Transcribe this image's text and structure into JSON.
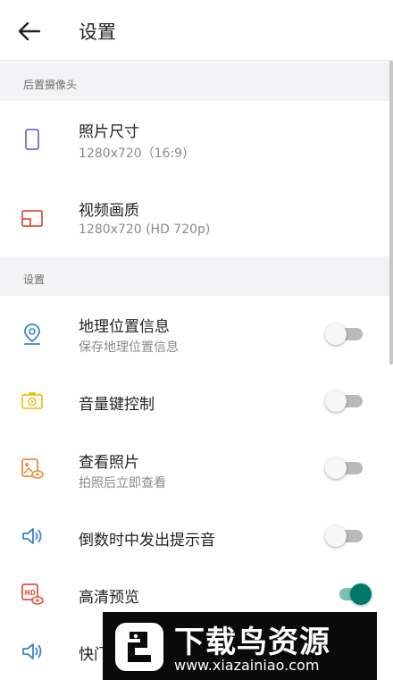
{
  "header": {
    "title": "设置",
    "back_icon": "arrow-left-icon"
  },
  "sections": [
    {
      "header": "后置摄像头"
    },
    {
      "header": "设置"
    }
  ],
  "camera_items": [
    {
      "label": "照片尺寸",
      "value": "1280x720（16:9)",
      "icon": "photo-size-icon",
      "color": "#7b68d6"
    },
    {
      "label": "视频画质",
      "value": "1280x720 (HD 720p)",
      "icon": "video-quality-icon",
      "color": "#e0533f"
    }
  ],
  "settings_items": [
    {
      "label": "地理位置信息",
      "description": "保存地理位置信息",
      "icon": "location-pin-icon",
      "color": "#3d85c6",
      "enabled": false
    },
    {
      "label": "音量键控制",
      "description": "",
      "icon": "volume-key-icon",
      "color": "#f0c020",
      "enabled": false
    },
    {
      "label": "查看照片",
      "description": "拍照后立即查看",
      "icon": "view-photo-icon",
      "color": "#ef8a3c",
      "enabled": false
    },
    {
      "label": "倒数时中发出提示音",
      "description": "",
      "icon": "speaker-icon",
      "color": "#3d85c6",
      "enabled": false
    },
    {
      "label": "高清预览",
      "description": "",
      "icon": "hd-preview-icon",
      "color": "#e0533f",
      "enabled": true
    },
    {
      "label": "快门",
      "description": "",
      "icon": "speaker-icon",
      "color": "#3d85c6",
      "enabled": false
    }
  ],
  "watermark": {
    "title": "下载鸟资源",
    "url": "www.xiazainiao.com"
  },
  "colors": {
    "toggle_on": "#00796b",
    "section_bg": "#f3f3f5"
  }
}
